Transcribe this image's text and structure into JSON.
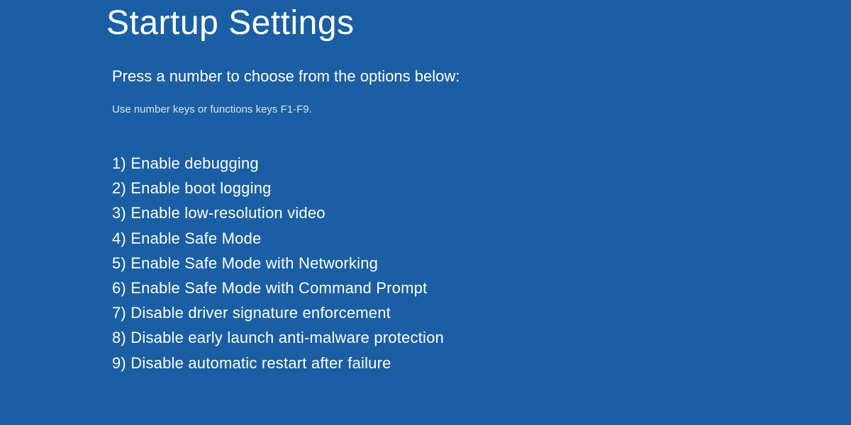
{
  "title": "Startup Settings",
  "instruction": "Press a number to choose from the options below:",
  "hint": "Use number keys or functions keys F1-F9.",
  "options": [
    "1) Enable debugging",
    "2) Enable boot logging",
    "3) Enable low-resolution video",
    "4) Enable Safe Mode",
    "5) Enable Safe Mode with Networking",
    "6) Enable Safe Mode with Command Prompt",
    "7) Disable driver signature enforcement",
    "8) Disable early launch anti-malware protection",
    "9) Disable automatic restart after failure"
  ]
}
